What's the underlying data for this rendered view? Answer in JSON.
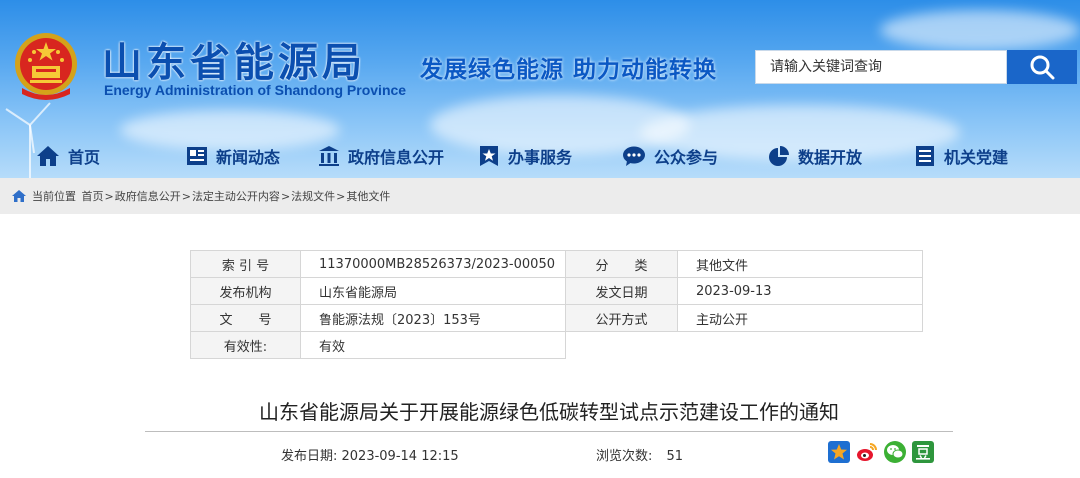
{
  "header": {
    "title": "山东省能源局",
    "subtitle": "Energy Administration of Shandong Province",
    "slogan": "发展绿色能源  助力动能转换",
    "search_placeholder": "请输入关键词查询"
  },
  "nav": [
    {
      "label": "首页",
      "icon": "home-icon"
    },
    {
      "label": "新闻动态",
      "icon": "news-icon"
    },
    {
      "label": "政府信息公开",
      "icon": "government-building-icon"
    },
    {
      "label": "办事服务",
      "icon": "star-badge-icon"
    },
    {
      "label": "公众参与",
      "icon": "chat-bubble-icon"
    },
    {
      "label": "数据开放",
      "icon": "pie-chart-icon"
    },
    {
      "label": "机关党建",
      "icon": "document-list-icon"
    }
  ],
  "breadcrumb": {
    "prefix": "当前位置",
    "items": [
      "首页",
      "政府信息公开",
      "法定主动公开内容",
      "法规文件",
      "其他文件"
    ]
  },
  "meta": {
    "index_label": "索 引 号",
    "index_value": "11370000MB28526373/2023-00050",
    "category_label": "分　　类",
    "category_value": "其他文件",
    "publisher_label": "发布机构",
    "publisher_value": "山东省能源局",
    "issue_date_label": "发文日期",
    "issue_date_value": "2023-09-13",
    "doc_no_label": "文　　号",
    "doc_no_value": "鲁能源法规〔2023〕153号",
    "disclosure_label": "公开方式",
    "disclosure_value": "主动公开",
    "validity_label": "有效性:",
    "validity_value": "有效"
  },
  "article": {
    "title": "山东省能源局关于开展能源绿色低碳转型试点示范建设工作的通知",
    "pub_date": "发布日期: 2023-09-14 12:15",
    "views_label": "浏览次数:",
    "views_value": "51"
  },
  "share": [
    {
      "icon": "qzone-star-icon",
      "color": "#f5a623"
    },
    {
      "icon": "weibo-icon",
      "color": "#e6162d"
    },
    {
      "icon": "wechat-icon",
      "color": "#3cb034"
    },
    {
      "icon": "douban-icon",
      "color": "#2e963d"
    }
  ]
}
